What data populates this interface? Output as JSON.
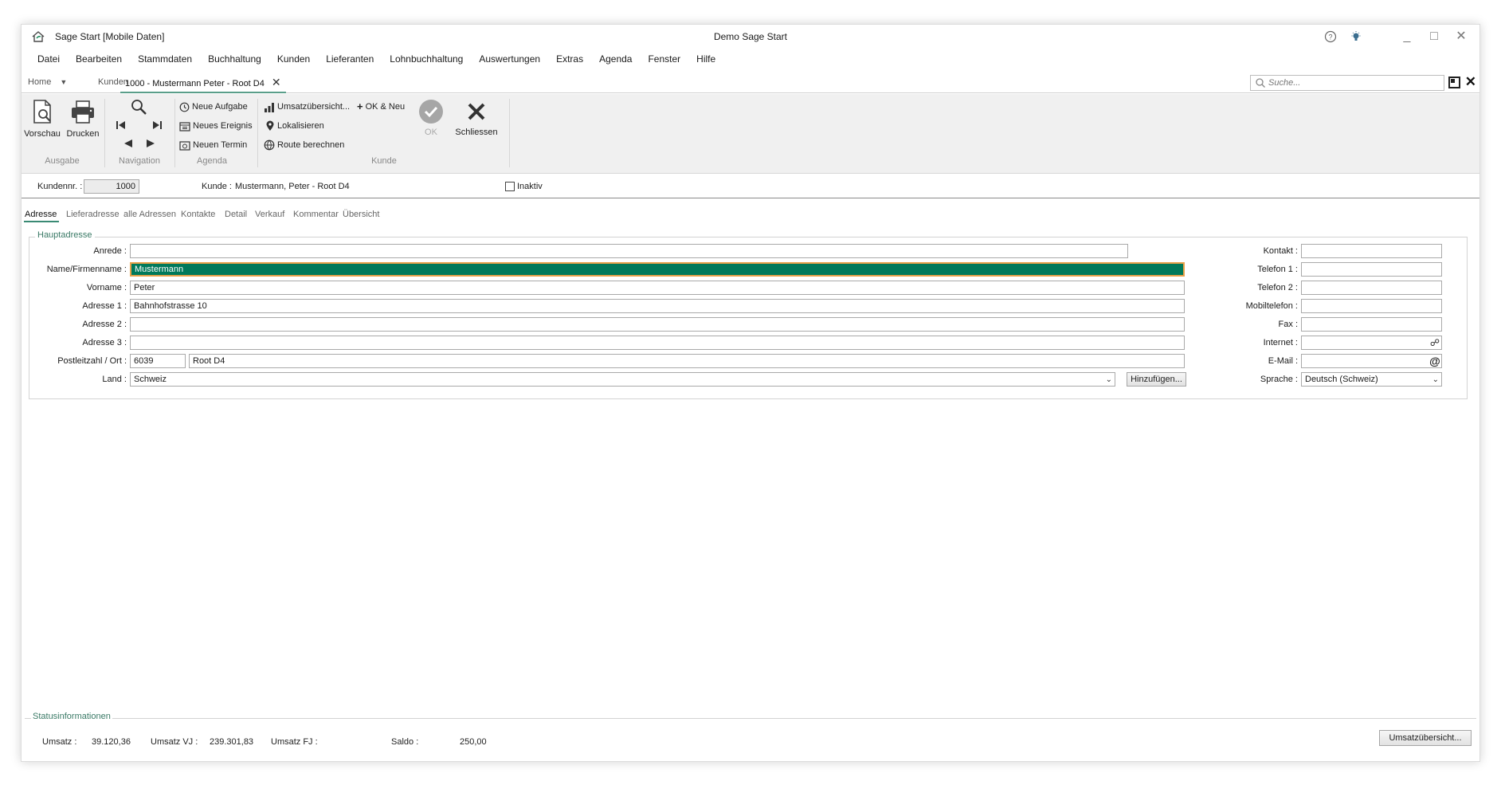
{
  "app_title": "Sage Start [Mobile Daten]",
  "window_title": "Demo Sage Start",
  "titlebar_icons": [
    "help-icon",
    "lightbulb-icon"
  ],
  "window_controls": {
    "minimize": "_",
    "restore": "□",
    "close": "✕"
  },
  "menu": [
    "Datei",
    "Bearbeiten",
    "Stammdaten",
    "Buchhaltung",
    "Kunden",
    "Lieferanten",
    "Lohnbuchhaltung",
    "Auswertungen",
    "Extras",
    "Agenda",
    "Fenster",
    "Hilfe"
  ],
  "tabs": {
    "home": "Home",
    "kunden": "Kunden",
    "active": "1000 - Mustermann Peter - Root D4"
  },
  "search": {
    "placeholder": "Suche..."
  },
  "ribbon": {
    "ausgabe": {
      "label": "Ausgabe",
      "vorschau": "Vorschau",
      "drucken": "Drucken"
    },
    "navigation": {
      "label": "Navigation"
    },
    "agenda": {
      "label": "Agenda",
      "neue_aufgabe": "Neue Aufgabe",
      "neues_ereignis": "Neues Ereignis",
      "neuen_termin": "Neuen Termin"
    },
    "kunde": {
      "label": "Kunde",
      "umsatz": "Umsatzübersicht...",
      "lokalisieren": "Lokalisieren",
      "route": "Route berechnen",
      "ok_neu": "OK & Neu",
      "ok": "OK",
      "schliessen": "Schliessen"
    }
  },
  "header": {
    "kundennr_label": "Kundennr. :",
    "kundennr_value": "1000",
    "kunde_label": "Kunde :",
    "kunde_value": "Mustermann, Peter - Root D4",
    "inaktiv_label": "Inaktiv"
  },
  "subtabs": [
    "Adresse",
    "Lieferadresse",
    "alle Adressen",
    "Kontakte",
    "Detail",
    "Verkauf",
    "Kommentar",
    "Übersicht"
  ],
  "form": {
    "legend": "Hauptadresse",
    "anrede": {
      "label": "Anrede :",
      "value": ""
    },
    "name": {
      "label": "Name/Firmenname :",
      "value": "Mustermann"
    },
    "vorname": {
      "label": "Vorname :",
      "value": "Peter"
    },
    "adresse1": {
      "label": "Adresse 1 :",
      "value": "Bahnhofstrasse 10"
    },
    "adresse2": {
      "label": "Adresse 2 :",
      "value": ""
    },
    "adresse3": {
      "label": "Adresse 3 :",
      "value": ""
    },
    "plz_ort": {
      "label": "Postleitzahl / Ort :",
      "plz": "6039",
      "ort": "Root D4"
    },
    "land": {
      "label": "Land :",
      "value": "Schweiz"
    },
    "hinzufuegen": "Hinzufügen...",
    "kontakt": {
      "label": "Kontakt :",
      "value": ""
    },
    "telefon1": {
      "label": "Telefon 1 :",
      "value": ""
    },
    "telefon2": {
      "label": "Telefon 2 :",
      "value": ""
    },
    "mobiltelefon": {
      "label": "Mobiltelefon :",
      "value": ""
    },
    "fax": {
      "label": "Fax :",
      "value": ""
    },
    "internet": {
      "label": "Internet :",
      "value": ""
    },
    "email": {
      "label": "E-Mail :",
      "value": ""
    },
    "sprache": {
      "label": "Sprache :",
      "value": "Deutsch (Schweiz)"
    }
  },
  "status": {
    "legend": "Statusinformationen",
    "umsatz_label": "Umsatz :",
    "umsatz_value": "39.120,36",
    "umsatz_vj_label": "Umsatz VJ :",
    "umsatz_vj_value": "239.301,83",
    "umsatz_fj_label": "Umsatz FJ :",
    "umsatz_fj_value": "",
    "saldo_label": "Saldo :",
    "saldo_value": "250,00",
    "button": "Umsatzübersicht..."
  }
}
